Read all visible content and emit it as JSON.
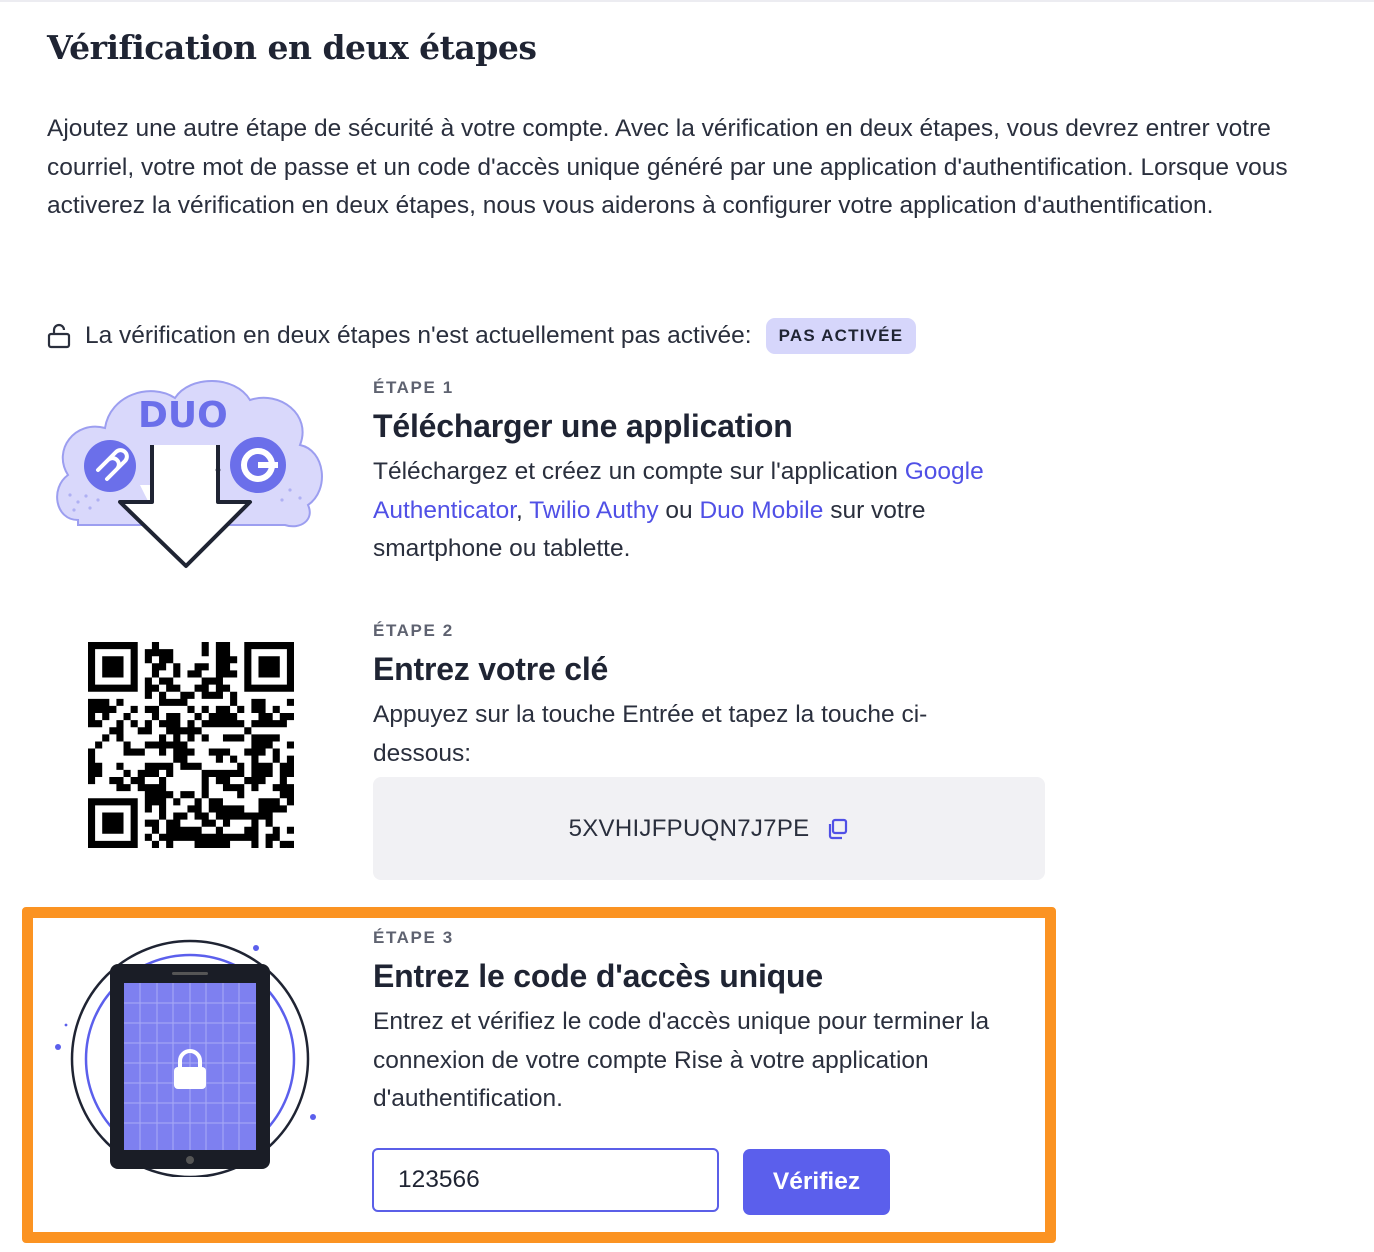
{
  "page": {
    "title": "Vérification en deux étapes",
    "intro": "Ajoutez une autre étape de sécurité à votre compte. Avec la vérification en deux étapes, vous devrez entrer votre courriel, votre mot de passe et un code d'accès unique généré par une application d'authentification. Lorsque vous activerez la vérification en deux étapes, nous vous aiderons à configurer votre application d'authentification."
  },
  "status": {
    "icon": "unlocked-lock-icon",
    "text": "La vérification en deux étapes n'est actuellement pas activée:",
    "badge": "PAS ACTIVÉE"
  },
  "steps": [
    {
      "label": "ÉTAPE 1",
      "title": "Télécharger une application",
      "desc_before": "Téléchargez et créez un compte sur l'application ",
      "link_google": "Google Authenticator",
      "sep_comma": ", ",
      "link_authy": "Twilio Authy",
      "sep_or": " ou ",
      "link_duo": "Duo Mobile",
      "desc_after": " sur votre smartphone ou tablette.",
      "illustration_text": "DUO"
    },
    {
      "label": "ÉTAPE 2",
      "title": "Entrez votre clé",
      "desc": "Appuyez sur la touche Entrée et tapez la touche ci-dessous:",
      "key": "5XVHIJFPUQN7J7PE",
      "copy_icon": "copy-icon"
    },
    {
      "label": "ÉTAPE 3",
      "title": "Entrez le code d'accès unique",
      "desc": "Entrez et vérifiez le code d'accès unique pour terminer la connexion de votre compte Rise à votre application d'authentification.",
      "input_value": "123566",
      "button_label": "Vérifiez"
    }
  ],
  "colors": {
    "accent": "#5b5fec",
    "link": "#5050e6",
    "highlight": "#fb9322",
    "badge_bg": "#d6d6fb"
  }
}
